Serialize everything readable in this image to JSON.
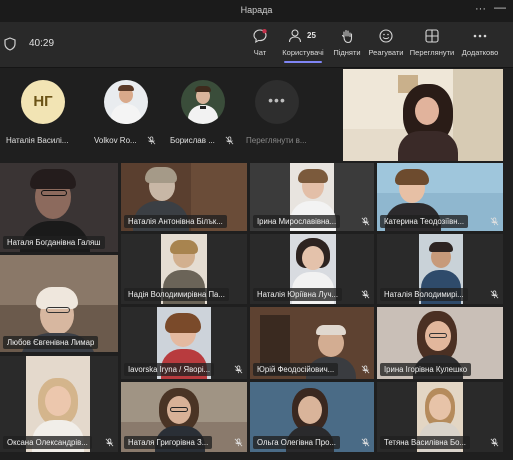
{
  "window": {
    "title": "Нарада"
  },
  "toolbar": {
    "timer": "40:29",
    "chat_label": "Чат",
    "participants_label": "Користувачі",
    "participants_count": "25",
    "raise_label": "Підняти",
    "react_label": "Реагувати",
    "view_label": "Переглянути",
    "more_label": "Додатково"
  },
  "avatars": [
    {
      "initials": "НГ",
      "name": "Наталія Василі..."
    },
    {
      "name": "Volkov Ro..."
    },
    {
      "name": "Борислав ..."
    },
    {
      "name": "Переглянути в..."
    }
  ],
  "tiles": [
    {
      "name": "Наталя Богданівна Галяш"
    },
    {
      "name": "Наталія Антонівна Білък..."
    },
    {
      "name": "Ірина Мирославівна..."
    },
    {
      "name": "Катерина Теодозіївн..."
    },
    {
      "name": "Надія Володимирівна Па..."
    },
    {
      "name": "Наталія Юріївна Луч..."
    },
    {
      "name": "Наталія Володимирі..."
    },
    {
      "name": "Любов Євгенівна Лимар"
    },
    {
      "name": "Iavorska Iryna / Яворі..."
    },
    {
      "name": "Юрій Феодосійович..."
    },
    {
      "name": "Ірина Ігорівна Кулешко"
    },
    {
      "name": "Оксана Олександрів..."
    },
    {
      "name": "Наталя Григорівна З..."
    },
    {
      "name": "Ольга Олегівна Про..."
    },
    {
      "name": "Тетяна Василівна Бо..."
    }
  ],
  "colors": {
    "accent": "#7f85f5",
    "avatar_initials_bg": "#f2e4b4",
    "avatar_initials_fg": "#6b5316"
  }
}
